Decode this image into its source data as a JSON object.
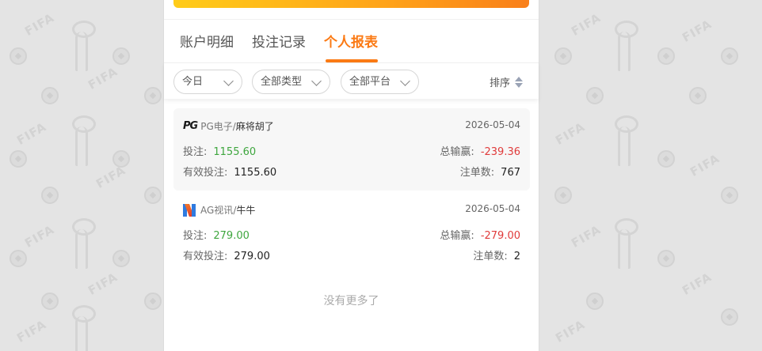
{
  "tabs": [
    {
      "label": "账户明细"
    },
    {
      "label": "投注记录"
    },
    {
      "label": "个人报表"
    }
  ],
  "active_tab": 2,
  "filters": {
    "date": "今日",
    "type": "全部类型",
    "platform": "全部平台",
    "sort": "排序"
  },
  "records": [
    {
      "platform": "PG电子",
      "logo_text": "PG",
      "game": "麻将胡了",
      "date": "2026-05-04",
      "bet_label": "投注:",
      "bet": "1155.60",
      "win_label": "总输赢:",
      "win": "-239.36",
      "valid_label": "有效投注:",
      "valid": "1155.60",
      "count_label": "注单数:",
      "count": "767"
    },
    {
      "platform": "AG视讯",
      "logo_text": "",
      "game": "牛牛",
      "date": "2026-05-04",
      "bet_label": "投注:",
      "bet": "279.00",
      "win_label": "总输赢:",
      "win": "-279.00",
      "valid_label": "有效投注:",
      "valid": "279.00",
      "count_label": "注单数:",
      "count": "2"
    }
  ],
  "footer": {
    "no_more": "没有更多了"
  },
  "colors": {
    "accent": "#fb7a14",
    "positive": "#3ea63e",
    "negative": "#e03b3b"
  }
}
